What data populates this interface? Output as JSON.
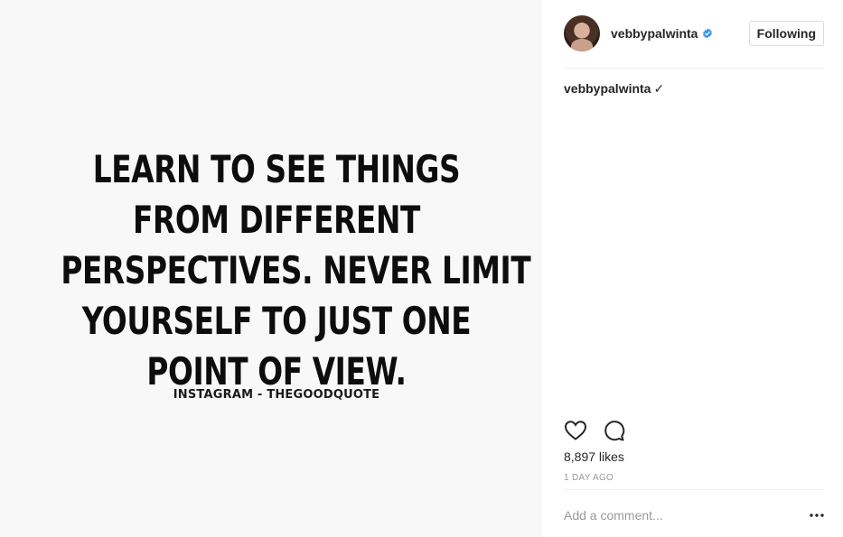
{
  "post": {
    "image": {
      "quote_lines": [
        "LEARN TO SEE THINGS",
        "FROM DIFFERENT",
        "PERSPECTIVES. NEVER LIMIT",
        "YOURSELF TO JUST ONE",
        "POINT OF VIEW."
      ],
      "credit": "INSTAGRAM - THEGOODQUOTE"
    },
    "header": {
      "username": "vebbypalwinta",
      "verified_icon": "verified-badge-icon",
      "follow_label": "Following"
    },
    "caption": {
      "username": "vebbypalwinta",
      "text": "✓"
    },
    "actions": {
      "like_icon": "heart-icon",
      "comment_icon": "comment-icon"
    },
    "likes": "8,897 likes",
    "time_ago": "1 DAY AGO",
    "comment": {
      "placeholder": "Add a comment...",
      "more_icon": "more-options-icon"
    }
  },
  "colors": {
    "image_bg": "#f8f8f8",
    "text": "#262626",
    "muted": "#999999",
    "verified": "#3897f0",
    "border": "#dbdbdb"
  }
}
